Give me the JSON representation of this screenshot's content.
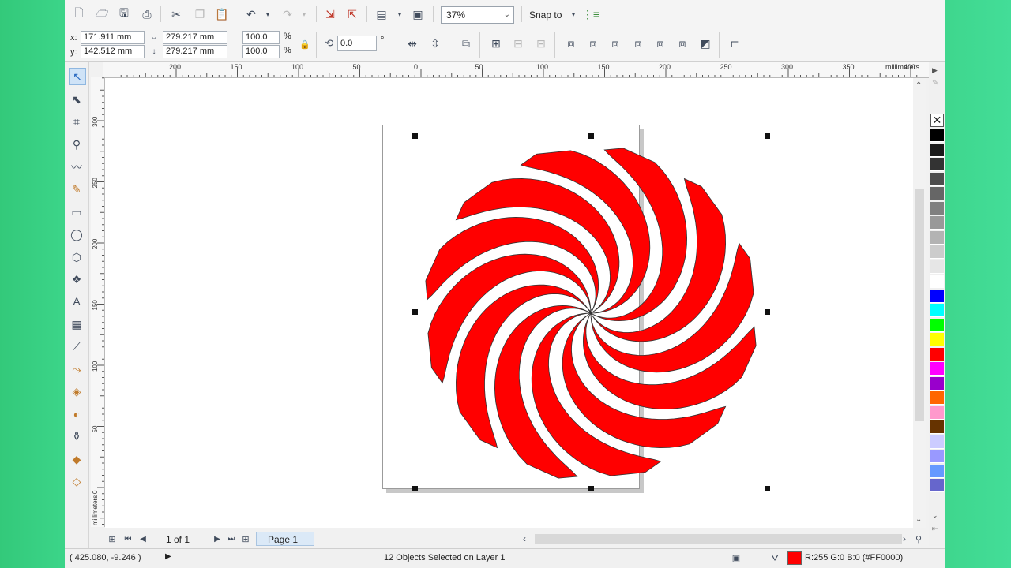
{
  "toolbar": {
    "zoom_value": "37%",
    "snap_label": "Snap to"
  },
  "property_bar": {
    "x_label": "x:",
    "y_label": "y:",
    "x_value": "171.911 mm",
    "y_value": "142.512 mm",
    "width_value": "279.217 mm",
    "height_value": "279.217 mm",
    "scale_x": "100.0",
    "scale_y": "100.0",
    "percent": "%",
    "rotation": "0.0",
    "degree": "°"
  },
  "ruler": {
    "unit": "millimeters",
    "h_ticks": [
      "200",
      "150",
      "100",
      "50",
      "0",
      "50",
      "100",
      "150",
      "200",
      "250",
      "300",
      "350",
      "400"
    ],
    "v_ticks": [
      "300",
      "250",
      "200",
      "150",
      "100",
      "50",
      "0"
    ]
  },
  "page_nav": {
    "page_count": "1 of 1",
    "page_tab": "Page 1"
  },
  "status": {
    "coords": "( 425.080, -9.246 )",
    "selection": "12 Objects Selected on Layer 1",
    "fill_info": "R:255 G:0 B:0 (#FF0000)"
  },
  "colors": {
    "fill": "#FF0000",
    "outline": "#333333",
    "background": "#3fd78e"
  },
  "artwork": {
    "type": "spiral-swirl",
    "arm_count": 12
  },
  "palette": [
    "#000000",
    "#1a1a1a",
    "#333333",
    "#4d4d4d",
    "#666666",
    "#808080",
    "#999999",
    "#b3b3b3",
    "#cccccc",
    "#e6e6e6",
    "#ffffff",
    "#0000ff",
    "#00ffff",
    "#00ff00",
    "#ffff00",
    "#ff0000",
    "#ff00ff",
    "#9900cc",
    "#ff6600",
    "#ff99cc",
    "#663300",
    "#ccccff",
    "#9999ff",
    "#6699ff",
    "#6666cc"
  ],
  "icons": {
    "new": "new-document-icon",
    "open": "open-folder-icon",
    "save": "save-icon",
    "print": "print-icon",
    "cut": "cut-icon",
    "copy": "copy-icon",
    "paste": "paste-icon",
    "undo": "undo-icon",
    "redo": "redo-icon",
    "import": "import-icon",
    "export": "export-icon",
    "publish": "publish-icon",
    "app_launcher": "app-launcher-icon",
    "snap_options": "snap-options-icon"
  }
}
